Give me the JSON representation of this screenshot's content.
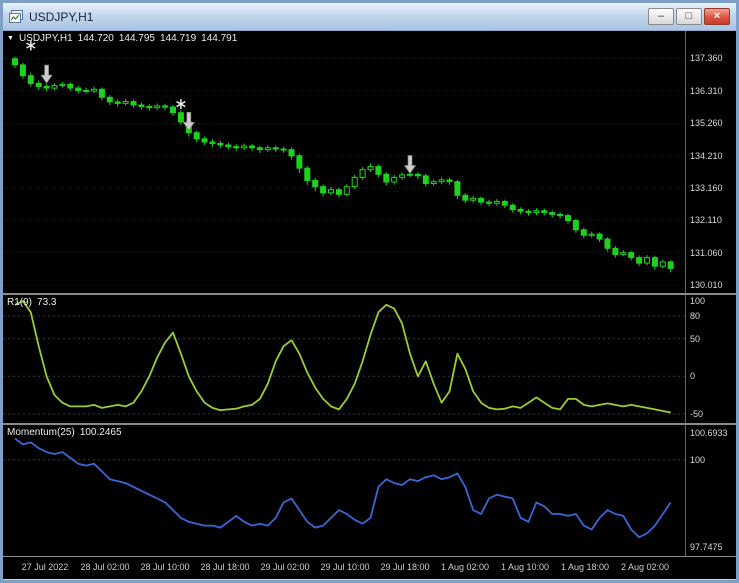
{
  "window": {
    "title": "USDJPY,H1",
    "controls": [
      {
        "name": "minimize",
        "glyph": "–"
      },
      {
        "name": "maximize",
        "glyph": "□"
      },
      {
        "name": "close",
        "glyph": "×"
      }
    ]
  },
  "main_legend": {
    "dropdown": "▼",
    "symbol_period": "USDJPY,H1",
    "open": "144.720",
    "high": "144.795",
    "low": "144.719",
    "close": "144.791"
  },
  "wpr_legend": {
    "name": "R1(9)",
    "value": "73.3"
  },
  "momentum_legend": {
    "name": "Momentum(25)",
    "value": "100.2465"
  },
  "colors": {
    "background": "#000000",
    "candle": "#1fd11f",
    "grid": "#242424",
    "level_line": "#383838",
    "wpr_line": "#9acd32",
    "momentum_line": "#3a66d6",
    "axis_text": "#d9d9d9",
    "titlebar": "#bfd4ec",
    "frame": "#7fa0c6",
    "close_button": "#d9503c",
    "marker": "#cdcdcd"
  },
  "chart_data": [
    {
      "type": "candlestick",
      "title": "USDJPY H1 price",
      "ylim": [
        129.75,
        138.25
      ],
      "y_axis_labels": [
        "137.360",
        "136.310",
        "135.260",
        "134.210",
        "133.160",
        "132.110",
        "131.060",
        "130.010"
      ],
      "x_axis_labels": [
        "27 Jul 2022",
        "28 Jul 02:00",
        "28 Jul 10:00",
        "28 Jul 18:00",
        "29 Jul 02:00",
        "29 Jul 10:00",
        "29 Jul 18:00",
        "1 Aug 02:00",
        "1 Aug 10:00",
        "1 Aug 18:00",
        "2 Aug 02:00"
      ],
      "open": [
        137.35,
        137.15,
        136.8,
        136.55,
        136.45,
        136.4,
        136.48,
        136.52,
        136.4,
        136.32,
        136.3,
        136.36,
        136.1,
        135.95,
        135.9,
        135.96,
        135.85,
        135.8,
        135.76,
        135.82,
        135.78,
        135.6,
        135.3,
        134.95,
        134.75,
        134.65,
        134.6,
        134.55,
        134.5,
        134.46,
        134.52,
        134.46,
        134.4,
        134.46,
        134.42,
        134.4,
        134.2,
        133.8,
        133.4,
        133.2,
        133.0,
        133.1,
        132.95,
        133.2,
        133.5,
        133.75,
        133.85,
        133.6,
        133.35,
        133.5,
        133.58,
        133.6,
        133.55,
        133.3,
        133.36,
        133.42,
        133.36,
        132.92,
        132.76,
        132.82,
        132.7,
        132.66,
        132.72,
        132.6,
        132.46,
        132.4,
        132.36,
        132.42,
        132.36,
        132.3,
        132.26,
        132.1,
        131.8,
        131.62,
        131.66,
        131.5,
        131.2,
        131.0,
        131.06,
        130.9,
        130.72,
        130.9,
        130.62,
        130.76
      ],
      "high": [
        137.42,
        137.22,
        136.9,
        136.64,
        136.53,
        136.56,
        136.6,
        136.58,
        136.47,
        136.41,
        136.45,
        136.42,
        136.17,
        136.03,
        136.04,
        136.02,
        135.93,
        135.88,
        135.9,
        135.89,
        135.85,
        135.68,
        135.38,
        135.02,
        134.83,
        134.73,
        134.68,
        134.63,
        134.58,
        134.6,
        134.59,
        134.53,
        134.54,
        134.53,
        134.5,
        134.47,
        134.27,
        133.87,
        133.48,
        133.27,
        133.2,
        133.17,
        133.28,
        133.58,
        133.83,
        133.95,
        133.92,
        133.67,
        133.58,
        133.66,
        133.7,
        133.67,
        133.62,
        133.44,
        133.5,
        133.49,
        133.42,
        132.99,
        132.9,
        132.88,
        132.78,
        132.8,
        132.78,
        132.66,
        132.53,
        132.47,
        132.5,
        132.49,
        132.43,
        132.37,
        132.32,
        132.16,
        131.87,
        131.74,
        131.72,
        131.56,
        131.27,
        131.14,
        131.12,
        130.97,
        130.98,
        130.96,
        130.84,
        130.82
      ],
      "low": [
        137.05,
        136.7,
        136.45,
        136.34,
        136.3,
        136.33,
        136.41,
        136.31,
        136.22,
        136.21,
        136.23,
        136.0,
        135.85,
        135.8,
        135.83,
        135.76,
        135.7,
        135.66,
        135.69,
        135.68,
        135.5,
        135.2,
        134.82,
        134.64,
        134.55,
        134.5,
        134.45,
        134.4,
        134.36,
        134.39,
        134.36,
        134.3,
        134.33,
        134.32,
        134.3,
        134.08,
        133.65,
        133.25,
        133.05,
        132.88,
        132.92,
        132.85,
        132.88,
        133.12,
        133.42,
        133.68,
        133.5,
        133.25,
        133.27,
        133.42,
        133.5,
        133.45,
        133.2,
        133.22,
        133.28,
        133.26,
        132.8,
        132.66,
        132.68,
        132.6,
        132.56,
        132.58,
        132.5,
        132.36,
        132.3,
        132.26,
        132.28,
        132.26,
        132.2,
        132.16,
        132.0,
        131.7,
        131.52,
        131.54,
        131.4,
        131.1,
        130.9,
        130.94,
        130.8,
        130.62,
        130.64,
        130.5,
        130.54,
        130.42
      ],
      "close": [
        137.15,
        136.8,
        136.55,
        136.45,
        136.4,
        136.48,
        136.52,
        136.4,
        136.32,
        136.3,
        136.36,
        136.1,
        135.95,
        135.9,
        135.96,
        135.85,
        135.8,
        135.76,
        135.82,
        135.78,
        135.6,
        135.3,
        134.95,
        134.75,
        134.65,
        134.6,
        134.55,
        134.5,
        134.46,
        134.52,
        134.46,
        134.4,
        134.46,
        134.42,
        134.4,
        134.2,
        133.8,
        133.4,
        133.2,
        133.0,
        133.1,
        132.95,
        133.2,
        133.5,
        133.75,
        133.85,
        133.6,
        133.35,
        133.5,
        133.58,
        133.6,
        133.55,
        133.3,
        133.36,
        133.42,
        133.36,
        132.92,
        132.76,
        132.82,
        132.7,
        132.66,
        132.72,
        132.6,
        132.46,
        132.4,
        132.36,
        132.42,
        132.36,
        132.3,
        132.26,
        132.1,
        131.8,
        131.62,
        131.66,
        131.5,
        131.2,
        131.0,
        131.06,
        130.9,
        130.72,
        130.9,
        130.62,
        130.76,
        130.55
      ],
      "markers": [
        {
          "type": "star",
          "index": 2,
          "price": 137.78
        },
        {
          "type": "down-arrow",
          "index": 4,
          "price": 136.85
        },
        {
          "type": "star",
          "index": 21,
          "price": 135.88
        },
        {
          "type": "down-arrow",
          "index": 22,
          "price": 135.32
        },
        {
          "type": "down-arrow",
          "index": 50,
          "price": 133.92
        }
      ]
    },
    {
      "type": "line",
      "name": "R1(9)",
      "current_value": "73.3",
      "ylim": [
        -62,
        108
      ],
      "axis_labels": [
        "100",
        "80",
        "50",
        "0",
        "-50"
      ],
      "levels": [
        80,
        50,
        0,
        -50
      ],
      "values": [
        95,
        100,
        85,
        40,
        0,
        -25,
        -35,
        -40,
        -40,
        -40,
        -38,
        -42,
        -40,
        -38,
        -40,
        -35,
        -20,
        0,
        25,
        45,
        58,
        30,
        0,
        -20,
        -35,
        -42,
        -45,
        -44,
        -43,
        -40,
        -38,
        -30,
        -10,
        20,
        40,
        48,
        30,
        5,
        -15,
        -30,
        -40,
        -44,
        -30,
        -10,
        20,
        55,
        85,
        95,
        90,
        70,
        30,
        0,
        20,
        -10,
        -35,
        -20,
        30,
        10,
        -20,
        -35,
        -42,
        -44,
        -43,
        -40,
        -42,
        -35,
        -28,
        -35,
        -42,
        -44,
        -30,
        -30,
        -38,
        -40,
        -38,
        -36,
        -38,
        -40,
        -38,
        -40,
        -42,
        -44,
        -46,
        -48
      ]
    },
    {
      "type": "line",
      "name": "Momentum(25)",
      "current_value": "100.2465",
      "ylim": [
        97.515,
        100.9
      ],
      "axis_labels": [
        "100.6933",
        "100",
        "97.7475"
      ],
      "levels": [
        100
      ],
      "values": [
        100.55,
        100.4,
        100.45,
        100.3,
        100.2,
        100.15,
        100.2,
        100.05,
        99.9,
        99.85,
        99.9,
        99.7,
        99.5,
        99.45,
        99.4,
        99.3,
        99.2,
        99.1,
        99.0,
        98.9,
        98.7,
        98.5,
        98.4,
        98.35,
        98.3,
        98.3,
        98.25,
        98.4,
        98.55,
        98.4,
        98.3,
        98.35,
        98.3,
        98.5,
        98.9,
        99.0,
        98.7,
        98.4,
        98.25,
        98.3,
        98.5,
        98.7,
        98.6,
        98.45,
        98.35,
        98.5,
        99.3,
        99.5,
        99.4,
        99.35,
        99.5,
        99.45,
        99.55,
        99.6,
        99.5,
        99.55,
        99.65,
        99.3,
        98.7,
        98.6,
        99.0,
        99.1,
        99.05,
        99.0,
        98.5,
        98.4,
        98.9,
        98.8,
        98.6,
        98.6,
        98.55,
        98.6,
        98.3,
        98.2,
        98.5,
        98.7,
        98.6,
        98.55,
        98.2,
        98.0,
        98.1,
        98.3,
        98.6,
        98.9
      ]
    }
  ]
}
